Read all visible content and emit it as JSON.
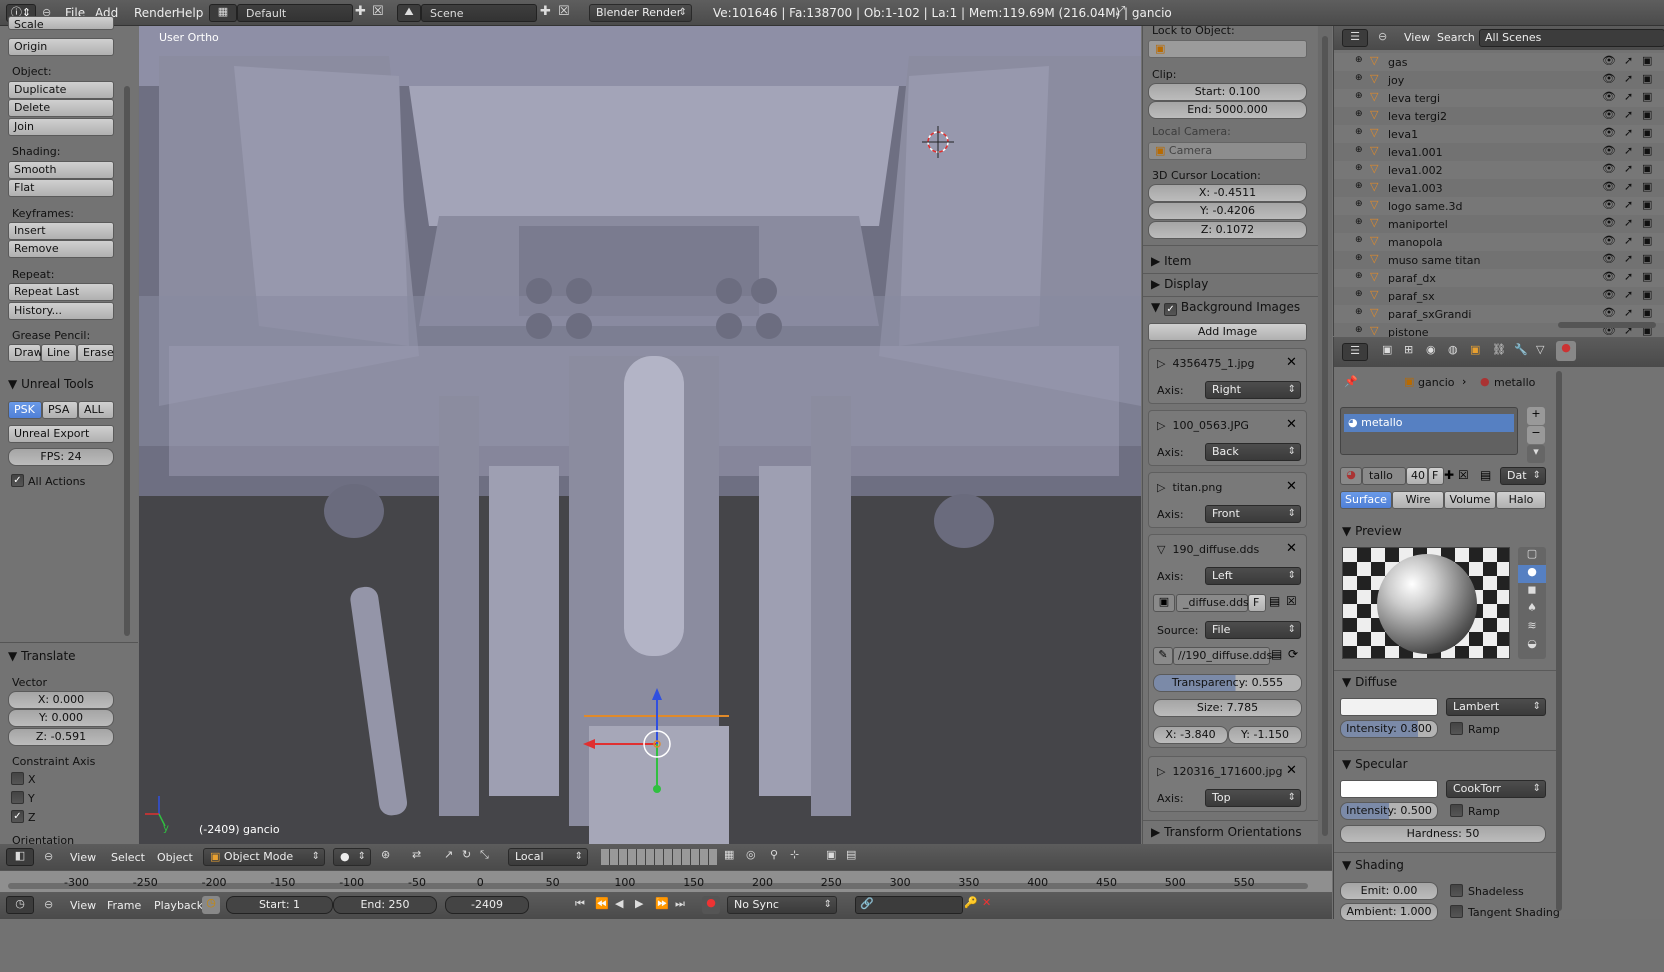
{
  "topbar": {
    "menus": [
      "File",
      "Add",
      "Render",
      "Help"
    ],
    "layout": "Default",
    "scene": "Scene",
    "engine": "Blender Render",
    "stats": "Ve:101646 | Fa:138700 | Ob:1-102 | La:1 | Mem:119.69M (216.04M) | gancio"
  },
  "left": {
    "cut": "Scale",
    "object_label": "Object:",
    "object_buttons": [
      "Duplicate",
      "Delete",
      "Join"
    ],
    "origin": "Origin",
    "shading_label": "Shading:",
    "shading_buttons": [
      "Smooth",
      "Flat"
    ],
    "keyframes_label": "Keyframes:",
    "keyframe_buttons": [
      "Insert",
      "Remove"
    ],
    "repeat_label": "Repeat:",
    "repeat_buttons": [
      "Repeat Last",
      "History..."
    ],
    "grease_label": "Grease Pencil:",
    "grease_buttons": [
      "Draw",
      "Line",
      "Erase"
    ],
    "unreal_title": "Unreal Tools",
    "unreal_tabs": [
      "PSK",
      "PSA",
      "ALL"
    ],
    "unreal_export": "Unreal Export",
    "fps": "FPS: 24",
    "all_actions": "All Actions",
    "translate_title": "Translate",
    "vector_label": "Vector",
    "vector": [
      "X: 0.000",
      "Y: 0.000",
      "Z: -0.591"
    ],
    "constraint_label": "Constraint Axis",
    "constraints": [
      "X",
      "Y",
      "Z"
    ],
    "orientation_label": "Orientation"
  },
  "viewport": {
    "view_name": "User Ortho",
    "status": "(-2409) gancio"
  },
  "props": {
    "lock_label": "Lock to Object:",
    "clip_label": "Clip:",
    "clip_start": "Start: 0.100",
    "clip_end": "End: 5000.000",
    "local_camera": "Local Camera:",
    "camera": "Camera",
    "cursor_label": "3D Cursor Location:",
    "cursor": [
      "X: -0.4511",
      "Y: -0.4206",
      "Z: 0.1072"
    ],
    "item": "Item",
    "display": "Display",
    "bg_images": "Background Images",
    "add_image": "Add Image",
    "images": [
      {
        "name": "4356475_1.jpg",
        "axis": "Right"
      },
      {
        "name": "100_0563.JPG",
        "axis": "Back"
      },
      {
        "name": "titan.png",
        "axis": "Front"
      },
      {
        "name": "190_diffuse.dds",
        "axis": "Left"
      },
      {
        "name": "120316_171600.jpg",
        "axis": "Top"
      }
    ],
    "axis_label": "Axis:",
    "file_field": "_diffuse.dds",
    "file_flag": "F",
    "source_label": "Source:",
    "source": "File",
    "path": "//190_diffuse.dds",
    "transparency": "Transparency: 0.555",
    "size": "Size: 7.785",
    "offset_x": "X: -3.840",
    "offset_y": "Y: -1.150",
    "transform_orientations": "Transform Orientations"
  },
  "outliner": {
    "menus": [
      "View",
      "Search"
    ],
    "scope": "All Scenes",
    "items": [
      "gas",
      "joy",
      "leva tergi",
      "leva tergi2",
      "leva1",
      "leva1.001",
      "leva1.002",
      "leva1.003",
      "logo same.3d",
      "maniportel",
      "manopola",
      "muso same titan",
      "paraf_dx",
      "paraf_sx",
      "paraf_sxGrandi",
      "pistone"
    ]
  },
  "material": {
    "breadcrumb_obj": "gancio",
    "breadcrumb_mat": "metallo",
    "slot": "metallo",
    "mat_name": "tallo",
    "users": "40",
    "flag": "F",
    "data": "Dat",
    "tabs": [
      "Surface",
      "Wire",
      "Volume",
      "Halo"
    ],
    "preview": "Preview",
    "diffuse": "Diffuse",
    "diffuse_shader": "Lambert",
    "diffuse_intensity": "Intensity: 0.800",
    "ramp": "Ramp",
    "specular": "Specular",
    "spec_shader": "CookTorr",
    "spec_intensity": "Intensity: 0.500",
    "hardness": "Hardness: 50",
    "shading": "Shading",
    "emit": "Emit: 0.00",
    "shadeless": "Shadeless",
    "ambient": "Ambient: 1.000",
    "tangent": "Tangent Shading"
  },
  "view_header": {
    "menus": [
      "View",
      "Select",
      "Object"
    ],
    "mode": "Object Mode",
    "pivot": "Local"
  },
  "timeline": {
    "ticks": [
      "-300",
      "-250",
      "-200",
      "-150",
      "-100",
      "-50",
      "0",
      "50",
      "100",
      "150",
      "200",
      "250",
      "300",
      "350",
      "400",
      "450",
      "500",
      "550"
    ],
    "menus": [
      "View",
      "Frame",
      "Playback"
    ],
    "start": "Start: 1",
    "end": "End: 250",
    "current": "-2409",
    "sync": "No Sync"
  }
}
